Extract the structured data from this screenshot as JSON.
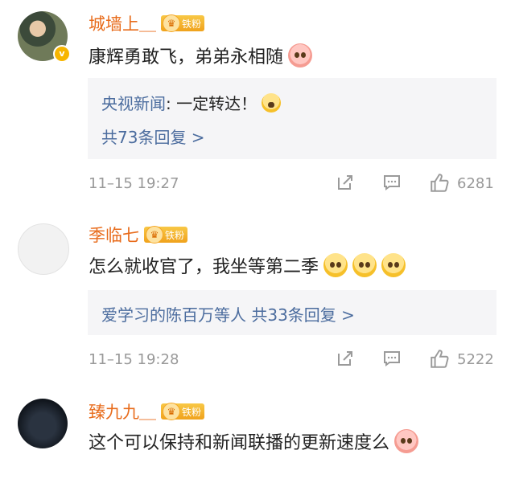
{
  "comments": [
    {
      "username": "城墙上＿",
      "badge": "铁粉",
      "verified": true,
      "text": "康辉勇敢飞，弟弟永相随",
      "reply": {
        "user": "央视新闻",
        "text": ": 一定转达！",
        "more": "共73条回复 >"
      },
      "time": "11–15 19:27",
      "likes": "6281"
    },
    {
      "username": "季临七",
      "badge": "铁粉",
      "verified": false,
      "text": "怎么就收官了，我坐等第二季",
      "reply": {
        "more": "爱学习的陈百万等人  共33条回复 >"
      },
      "time": "11–15 19:28",
      "likes": "5222"
    },
    {
      "username": "臻九九＿",
      "badge": "铁粉",
      "verified": false,
      "text": "这个可以保持和新闻联播的更新速度么"
    }
  ],
  "icons": {
    "repost": "share-icon",
    "comment": "comment-icon",
    "like": "thumbs-up-icon"
  },
  "colors": {
    "username": "#e86c1c",
    "link": "#4b6c9e",
    "reply_bg": "#f5f5f7",
    "meta": "#999999"
  }
}
